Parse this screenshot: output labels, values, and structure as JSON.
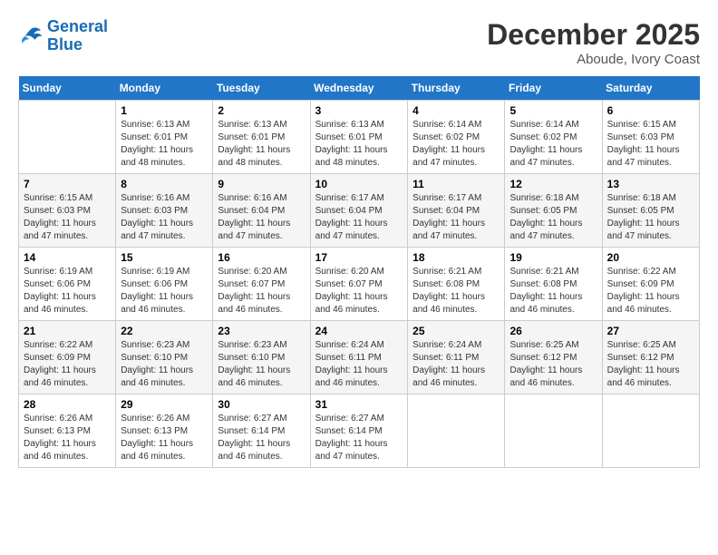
{
  "header": {
    "logo_line1": "General",
    "logo_line2": "Blue",
    "month": "December 2025",
    "location": "Aboude, Ivory Coast"
  },
  "weekdays": [
    "Sunday",
    "Monday",
    "Tuesday",
    "Wednesday",
    "Thursday",
    "Friday",
    "Saturday"
  ],
  "weeks": [
    [
      {
        "day": "",
        "sunrise": "",
        "sunset": "",
        "daylight": ""
      },
      {
        "day": "1",
        "sunrise": "Sunrise: 6:13 AM",
        "sunset": "Sunset: 6:01 PM",
        "daylight": "Daylight: 11 hours and 48 minutes."
      },
      {
        "day": "2",
        "sunrise": "Sunrise: 6:13 AM",
        "sunset": "Sunset: 6:01 PM",
        "daylight": "Daylight: 11 hours and 48 minutes."
      },
      {
        "day": "3",
        "sunrise": "Sunrise: 6:13 AM",
        "sunset": "Sunset: 6:01 PM",
        "daylight": "Daylight: 11 hours and 48 minutes."
      },
      {
        "day": "4",
        "sunrise": "Sunrise: 6:14 AM",
        "sunset": "Sunset: 6:02 PM",
        "daylight": "Daylight: 11 hours and 47 minutes."
      },
      {
        "day": "5",
        "sunrise": "Sunrise: 6:14 AM",
        "sunset": "Sunset: 6:02 PM",
        "daylight": "Daylight: 11 hours and 47 minutes."
      },
      {
        "day": "6",
        "sunrise": "Sunrise: 6:15 AM",
        "sunset": "Sunset: 6:03 PM",
        "daylight": "Daylight: 11 hours and 47 minutes."
      }
    ],
    [
      {
        "day": "7",
        "sunrise": "Sunrise: 6:15 AM",
        "sunset": "Sunset: 6:03 PM",
        "daylight": "Daylight: 11 hours and 47 minutes."
      },
      {
        "day": "8",
        "sunrise": "Sunrise: 6:16 AM",
        "sunset": "Sunset: 6:03 PM",
        "daylight": "Daylight: 11 hours and 47 minutes."
      },
      {
        "day": "9",
        "sunrise": "Sunrise: 6:16 AM",
        "sunset": "Sunset: 6:04 PM",
        "daylight": "Daylight: 11 hours and 47 minutes."
      },
      {
        "day": "10",
        "sunrise": "Sunrise: 6:17 AM",
        "sunset": "Sunset: 6:04 PM",
        "daylight": "Daylight: 11 hours and 47 minutes."
      },
      {
        "day": "11",
        "sunrise": "Sunrise: 6:17 AM",
        "sunset": "Sunset: 6:04 PM",
        "daylight": "Daylight: 11 hours and 47 minutes."
      },
      {
        "day": "12",
        "sunrise": "Sunrise: 6:18 AM",
        "sunset": "Sunset: 6:05 PM",
        "daylight": "Daylight: 11 hours and 47 minutes."
      },
      {
        "day": "13",
        "sunrise": "Sunrise: 6:18 AM",
        "sunset": "Sunset: 6:05 PM",
        "daylight": "Daylight: 11 hours and 47 minutes."
      }
    ],
    [
      {
        "day": "14",
        "sunrise": "Sunrise: 6:19 AM",
        "sunset": "Sunset: 6:06 PM",
        "daylight": "Daylight: 11 hours and 46 minutes."
      },
      {
        "day": "15",
        "sunrise": "Sunrise: 6:19 AM",
        "sunset": "Sunset: 6:06 PM",
        "daylight": "Daylight: 11 hours and 46 minutes."
      },
      {
        "day": "16",
        "sunrise": "Sunrise: 6:20 AM",
        "sunset": "Sunset: 6:07 PM",
        "daylight": "Daylight: 11 hours and 46 minutes."
      },
      {
        "day": "17",
        "sunrise": "Sunrise: 6:20 AM",
        "sunset": "Sunset: 6:07 PM",
        "daylight": "Daylight: 11 hours and 46 minutes."
      },
      {
        "day": "18",
        "sunrise": "Sunrise: 6:21 AM",
        "sunset": "Sunset: 6:08 PM",
        "daylight": "Daylight: 11 hours and 46 minutes."
      },
      {
        "day": "19",
        "sunrise": "Sunrise: 6:21 AM",
        "sunset": "Sunset: 6:08 PM",
        "daylight": "Daylight: 11 hours and 46 minutes."
      },
      {
        "day": "20",
        "sunrise": "Sunrise: 6:22 AM",
        "sunset": "Sunset: 6:09 PM",
        "daylight": "Daylight: 11 hours and 46 minutes."
      }
    ],
    [
      {
        "day": "21",
        "sunrise": "Sunrise: 6:22 AM",
        "sunset": "Sunset: 6:09 PM",
        "daylight": "Daylight: 11 hours and 46 minutes."
      },
      {
        "day": "22",
        "sunrise": "Sunrise: 6:23 AM",
        "sunset": "Sunset: 6:10 PM",
        "daylight": "Daylight: 11 hours and 46 minutes."
      },
      {
        "day": "23",
        "sunrise": "Sunrise: 6:23 AM",
        "sunset": "Sunset: 6:10 PM",
        "daylight": "Daylight: 11 hours and 46 minutes."
      },
      {
        "day": "24",
        "sunrise": "Sunrise: 6:24 AM",
        "sunset": "Sunset: 6:11 PM",
        "daylight": "Daylight: 11 hours and 46 minutes."
      },
      {
        "day": "25",
        "sunrise": "Sunrise: 6:24 AM",
        "sunset": "Sunset: 6:11 PM",
        "daylight": "Daylight: 11 hours and 46 minutes."
      },
      {
        "day": "26",
        "sunrise": "Sunrise: 6:25 AM",
        "sunset": "Sunset: 6:12 PM",
        "daylight": "Daylight: 11 hours and 46 minutes."
      },
      {
        "day": "27",
        "sunrise": "Sunrise: 6:25 AM",
        "sunset": "Sunset: 6:12 PM",
        "daylight": "Daylight: 11 hours and 46 minutes."
      }
    ],
    [
      {
        "day": "28",
        "sunrise": "Sunrise: 6:26 AM",
        "sunset": "Sunset: 6:13 PM",
        "daylight": "Daylight: 11 hours and 46 minutes."
      },
      {
        "day": "29",
        "sunrise": "Sunrise: 6:26 AM",
        "sunset": "Sunset: 6:13 PM",
        "daylight": "Daylight: 11 hours and 46 minutes."
      },
      {
        "day": "30",
        "sunrise": "Sunrise: 6:27 AM",
        "sunset": "Sunset: 6:14 PM",
        "daylight": "Daylight: 11 hours and 46 minutes."
      },
      {
        "day": "31",
        "sunrise": "Sunrise: 6:27 AM",
        "sunset": "Sunset: 6:14 PM",
        "daylight": "Daylight: 11 hours and 47 minutes."
      },
      {
        "day": "",
        "sunrise": "",
        "sunset": "",
        "daylight": ""
      },
      {
        "day": "",
        "sunrise": "",
        "sunset": "",
        "daylight": ""
      },
      {
        "day": "",
        "sunrise": "",
        "sunset": "",
        "daylight": ""
      }
    ]
  ]
}
